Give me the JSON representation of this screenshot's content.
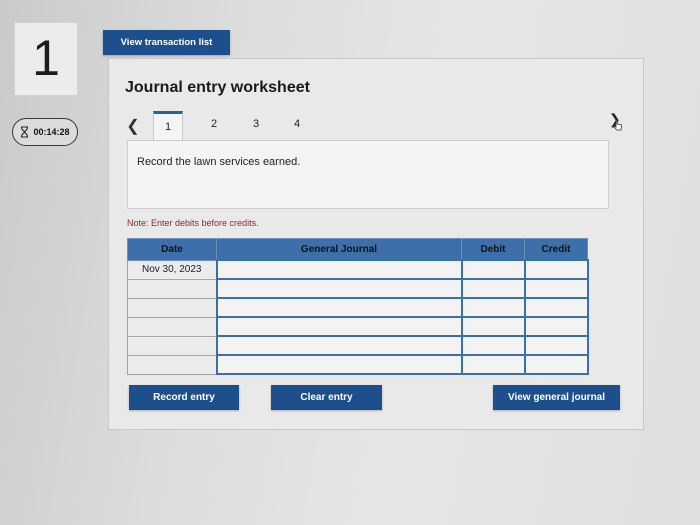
{
  "question": {
    "number": "1"
  },
  "timer": {
    "time": "00:14:28"
  },
  "top_button": {
    "label": "View transaction list"
  },
  "worksheet": {
    "title": "Journal entry worksheet",
    "tabs": [
      "1",
      "2",
      "3",
      "4"
    ],
    "active_tab": "1",
    "description": "Record the lawn services earned.",
    "note": "Note: Enter debits before credits."
  },
  "table": {
    "headers": {
      "date": "Date",
      "journal": "General Journal",
      "debit": "Debit",
      "credit": "Credit"
    },
    "rows": [
      {
        "date": "Nov 30, 2023",
        "account": "",
        "debit": "",
        "credit": ""
      },
      {
        "date": "",
        "account": "",
        "debit": "",
        "credit": ""
      },
      {
        "date": "",
        "account": "",
        "debit": "",
        "credit": ""
      },
      {
        "date": "",
        "account": "",
        "debit": "",
        "credit": ""
      },
      {
        "date": "",
        "account": "",
        "debit": "",
        "credit": ""
      },
      {
        "date": "",
        "account": "",
        "debit": "",
        "credit": ""
      }
    ]
  },
  "buttons": {
    "record": "Record entry",
    "clear": "Clear entry",
    "view_journal": "View general journal"
  },
  "colors": {
    "button_bg": "#1d4f8c",
    "header_bg": "#3d6fab",
    "note": "#8a2a2a"
  },
  "icons": [
    "hourglass-icon",
    "chevron-left-icon",
    "chevron-right-icon",
    "pointer-cursor-icon"
  ]
}
